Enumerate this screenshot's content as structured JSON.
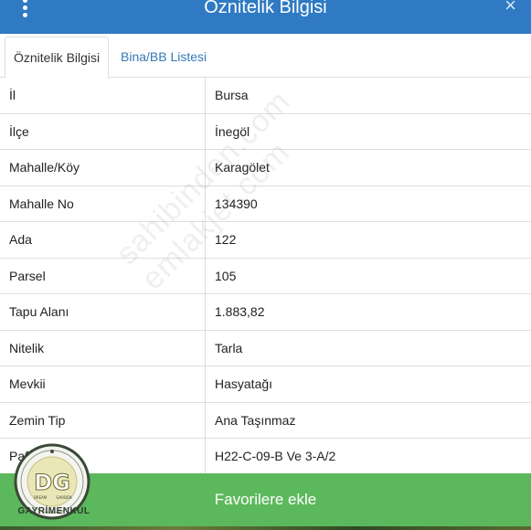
{
  "header": {
    "title": "Öznitelik Bilgisi",
    "close": "×"
  },
  "tabs": [
    {
      "label": "Öznitelik Bilgisi",
      "active": true
    },
    {
      "label": "Bina/BB Listesi",
      "active": false
    }
  ],
  "rows": [
    {
      "label": "İl",
      "value": "Bursa"
    },
    {
      "label": "İlçe",
      "value": "İnegöl"
    },
    {
      "label": "Mahalle/Köy",
      "value": "Karagölet"
    },
    {
      "label": "Mahalle No",
      "value": "134390"
    },
    {
      "label": "Ada",
      "value": "122"
    },
    {
      "label": "Parsel",
      "value": "105"
    },
    {
      "label": "Tapu Alanı",
      "value": "1.883,82"
    },
    {
      "label": "Nitelik",
      "value": "Tarla"
    },
    {
      "label": "Mevkii",
      "value": "Hasyatağı"
    },
    {
      "label": "Zemin Tip",
      "value": "Ana Taşınmaz"
    },
    {
      "label": "Pafta",
      "value": "H22-C-09-B Ve 3-A/2"
    }
  ],
  "watermark": "sahibinden.com emlakjet.com",
  "favorite_button": "Favorilere ekle",
  "logo": {
    "initials": "DG",
    "small_left": "DREAM",
    "small_right": "GARDEN",
    "name": "GAYRİMENKUL"
  },
  "colors": {
    "header": "#2f7ac3",
    "button": "#5cb85c",
    "link": "#337ab7"
  }
}
